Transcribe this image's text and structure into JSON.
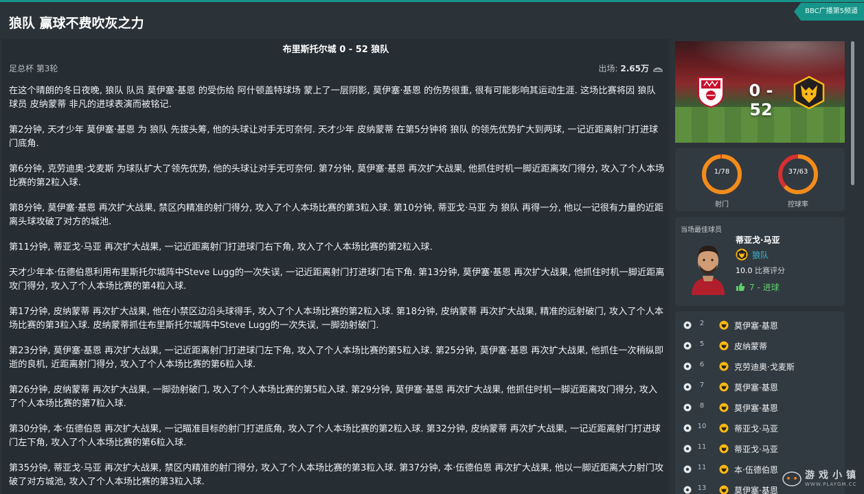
{
  "page": {
    "title": "狼队 赢球不费吹灰之力",
    "channel": "BBC广播第5频道"
  },
  "match": {
    "title": "布里斯托尔城 0 - 52 狼队",
    "competition": "足总杯 第3轮",
    "attendance_label": "出场:",
    "attendance_value": "2.65万"
  },
  "report": [
    "在这个晴朗的冬日夜晚, 狼队 队员 莫伊塞·基恩 的受伤给 阿什顿盖特球场 蒙上了一层阴影, 莫伊塞·基恩 的伤势很重, 很有可能影响其运动生涯. 这场比赛将因 狼队 球员 皮纳蒙蒂 非凡的进球表演而被铭记.",
    "第2分钟, 天才少年 莫伊塞·基恩 为 狼队 先拔头筹, 他的头球让对手无可奈何. 天才少年 皮纳蒙蒂 在第5分钟将 狼队 的领先优势扩大到两球, 一记近距离射门打进球门底角.",
    "第6分钟, 克劳迪奥·戈麦斯 为球队扩大了领先优势, 他的头球让对手无可奈何. 第7分钟, 莫伊塞·基恩 再次扩大战果, 他抓住时机一脚近距离攻门得分, 攻入了个人本场比赛的第2粒入球.",
    "第8分钟, 莫伊塞·基恩 再次扩大战果, 禁区内精准的射门得分, 攻入了个人本场比赛的第3粒入球. 第10分钟, 蒂亚戈·马亚 为 狼队 再得一分, 他以一记很有力量的近距离头球攻破了对方的城池.",
    "第11分钟, 蒂亚戈·马亚 再次扩大战果, 一记近距离射门打进球门右下角, 攻入了个人本场比赛的第2粒入球.",
    "天才少年本·伍德伯恩利用布里斯托尔城阵中Steve Lugg的一次失误, 一记近距离射门打进球门右下角. 第13分钟, 莫伊塞·基恩 再次扩大战果, 他抓住时机一脚近距离攻门得分, 攻入了个人本场比赛的第4粒入球.",
    "第17分钟, 皮纳蒙蒂 再次扩大战果, 他在小禁区边沿头球得手, 攻入了个人本场比赛的第2粒入球. 第18分钟, 皮纳蒙蒂 再次扩大战果, 精准的远射破门, 攻入了个人本场比赛的第3粒入球. 皮纳蒙蒂抓住布里斯托尔城阵中Steve Lugg的一次失误, 一脚劲射破门.",
    "第23分钟, 莫伊塞·基恩 再次扩大战果, 一记近距离射门打进球门左下角, 攻入了个人本场比赛的第5粒入球. 第25分钟, 莫伊塞·基恩 再次扩大战果, 他抓住一次稍纵即逝的良机, 近距离射门得分, 攻入了个人本场比赛的第6粒入球.",
    "第26分钟, 皮纳蒙蒂 再次扩大战果, 一脚劲射破门, 攻入了个人本场比赛的第5粒入球. 第29分钟, 莫伊塞·基恩 再次扩大战果, 他抓住时机一脚近距离攻门得分, 攻入了个人本场比赛的第7粒入球.",
    "第30分钟, 本·伍德伯恩 再次扩大战果, 一记瞄准目标的射门打进底角, 攻入了个人本场比赛的第2粒入球. 第32分钟, 皮纳蒙蒂 再次扩大战果, 一记近距离射门打进球门左下角, 攻入了个人本场比赛的第6粒入球.",
    "第35分钟, 蒂亚戈·马亚 再次扩大战果, 禁区内精准的射门得分, 攻入了个人本场比赛的第3粒入球. 第37分钟, 本·伍德伯恩 再次扩大战果, 他以一脚近距离大力射门攻破了对方城池, 攻入了个人本场比赛的第3粒入球."
  ],
  "scorecard": {
    "score": "0 - 52",
    "home_color": "#c8102e",
    "away_color": "#fdb913"
  },
  "stats": {
    "shots": {
      "text": "1/78",
      "label": "射门",
      "fraction": 0.987,
      "color": "#f28c1b"
    },
    "possession": {
      "text": "37/63",
      "label": "控球率",
      "fraction": 0.63,
      "home_color": "#d63031",
      "away_color": "#f28c1b"
    }
  },
  "motm": {
    "label": "当场最佳球员",
    "name": "蒂亚戈·马亚",
    "club": "狼队",
    "rating": "10.0",
    "rating_label": "比赛评分",
    "goals": "7 - 进球"
  },
  "events": [
    {
      "minute": "2",
      "scorer": "莫伊塞·基恩"
    },
    {
      "minute": "5",
      "scorer": "皮纳蒙蒂"
    },
    {
      "minute": "6",
      "scorer": "克劳迪奥·戈麦斯"
    },
    {
      "minute": "7",
      "scorer": "莫伊塞·基恩"
    },
    {
      "minute": "8",
      "scorer": "莫伊塞·基恩"
    },
    {
      "minute": "10",
      "scorer": "蒂亚戈·马亚"
    },
    {
      "minute": "11",
      "scorer": "蒂亚戈·马亚"
    },
    {
      "minute": "11",
      "scorer": "本·伍德伯恩"
    },
    {
      "minute": "13",
      "scorer": "莫伊塞·基恩"
    }
  ],
  "watermark": {
    "text": "游戏小镇",
    "url": "WWW.PLAYGM.CC"
  }
}
